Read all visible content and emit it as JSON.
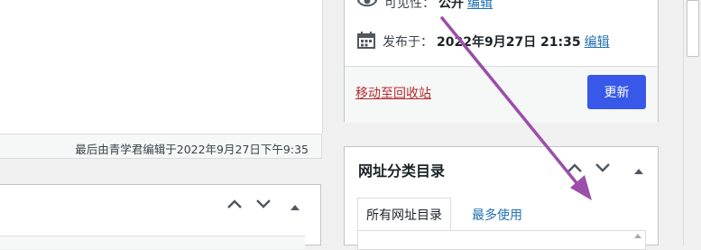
{
  "status_bar": {
    "last_edited": "最后由青学君编辑于2022年9月27日下午9:35"
  },
  "publish": {
    "visibility_label": "可见性：",
    "visibility_value": "公开",
    "visibility_edit": "编辑",
    "publish_label": "发布于：",
    "publish_date": "2022年9月27日 21:35",
    "publish_edit": "编辑",
    "trash_link": "移动至回收站",
    "update_button": "更新"
  },
  "taxonomy": {
    "title": "网址分类目录",
    "tab_all": "所有网址目录",
    "tab_popular": "最多使用"
  },
  "colors": {
    "accent": "#3858e9",
    "link": "#2271b1",
    "danger": "#b32d2e",
    "annotation_arrow": "#9b4fa8"
  },
  "icons": [
    "eye-icon",
    "calendar-icon",
    "chevron-up-icon",
    "chevron-down-icon",
    "triangle-up-icon",
    "scroll-up-icon"
  ]
}
